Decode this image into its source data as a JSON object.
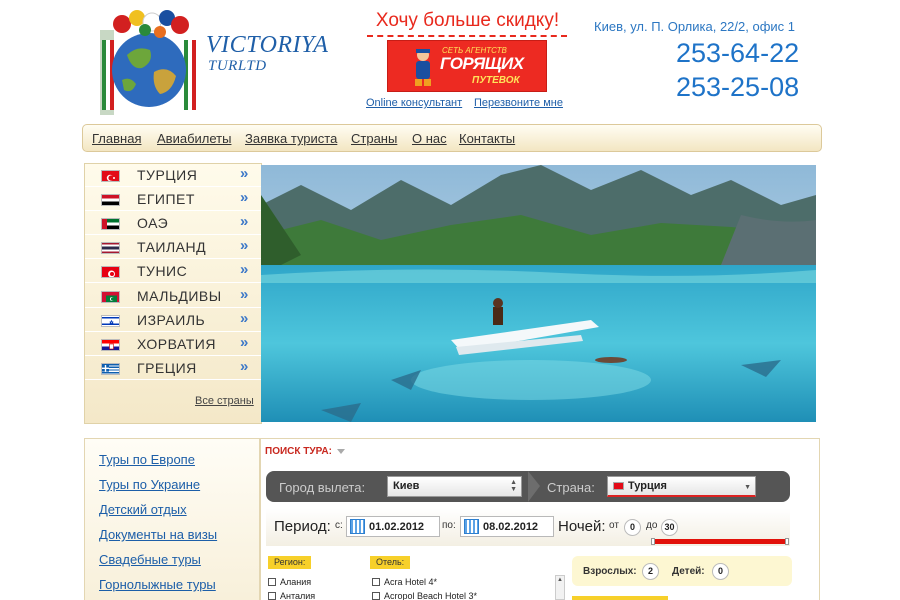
{
  "brand": {
    "name": "VICTORIYA",
    "sub": "TURLTD"
  },
  "promo": {
    "title": "Хочу больше скидку!",
    "banner_small": "СЕТЬ АГЕНТСТВ",
    "banner_big": "ГОРЯЩИХ",
    "banner_sub": "ПУТЕВОК",
    "online_link": "Online консультант",
    "callback_link": "Перезвоните мне"
  },
  "contacts": {
    "address": "Киев, ул. П. Орлика, 22/2, офис 1",
    "phone1": "253-64-22",
    "phone2": "253-25-08"
  },
  "nav": [
    "Главная",
    "Авиабилеты",
    "Заявка туриста",
    "Страны",
    "О нас",
    "Контакты"
  ],
  "countries": [
    {
      "name": "ТУРЦИЯ",
      "arrow": "»",
      "flag_icon": "turkey-flag-icon"
    },
    {
      "name": "ЕГИПЕТ",
      "arrow": "»",
      "flag_icon": "egypt-flag-icon"
    },
    {
      "name": "ОАЭ",
      "arrow": "»",
      "flag_icon": "uae-flag-icon"
    },
    {
      "name": "ТАИЛАНД",
      "arrow": "»",
      "flag_icon": "thailand-flag-icon"
    },
    {
      "name": "ТУНИС",
      "arrow": "»",
      "flag_icon": "tunisia-flag-icon"
    },
    {
      "name": "МАЛЬДИВЫ",
      "arrow": "»",
      "flag_icon": "maldives-flag-icon"
    },
    {
      "name": "ИЗРАИЛЬ",
      "arrow": "»",
      "flag_icon": "israel-flag-icon"
    },
    {
      "name": "ХОРВАТИЯ",
      "arrow": "»",
      "flag_icon": "croatia-flag-icon"
    },
    {
      "name": "ГРЕЦИЯ",
      "arrow": "»",
      "flag_icon": "greece-flag-icon"
    }
  ],
  "all_countries": "Все страны",
  "tours": [
    "Туры по Европе",
    "Туры по Украине",
    "Детский отдых",
    "Документы на визы",
    "Свадебные туры",
    "Горнолыжные туры"
  ],
  "search": {
    "title": "ПОИСК ТУРА:",
    "departure_label": "Город вылета:",
    "departure_value": "Киев",
    "country_label": "Страна:",
    "country_value": "Турция",
    "period_label": "Период:",
    "from_label": "с:",
    "date_from": "01.02.2012",
    "to_label": "по:",
    "date_to": "08.02.2012",
    "nights_label": "Ночей:",
    "nights_from_label": "от",
    "nights_from": "0",
    "nights_to_label": "до",
    "nights_to": "30",
    "region_label": "Регион:",
    "regions": [
      "Алания",
      "Анталия"
    ],
    "hotel_label": "Отель:",
    "hotels": [
      "Acra Hotel 4*",
      "Acropol Beach Hotel 3*"
    ],
    "adults_label": "Взрослых:",
    "adults": "2",
    "children_label": "Детей:",
    "children": "0"
  },
  "colors": {
    "accent_blue": "#1e73c8",
    "promo_red": "#e8291d",
    "search_bar": "#555555",
    "tag_yellow": "#f7d02a"
  }
}
